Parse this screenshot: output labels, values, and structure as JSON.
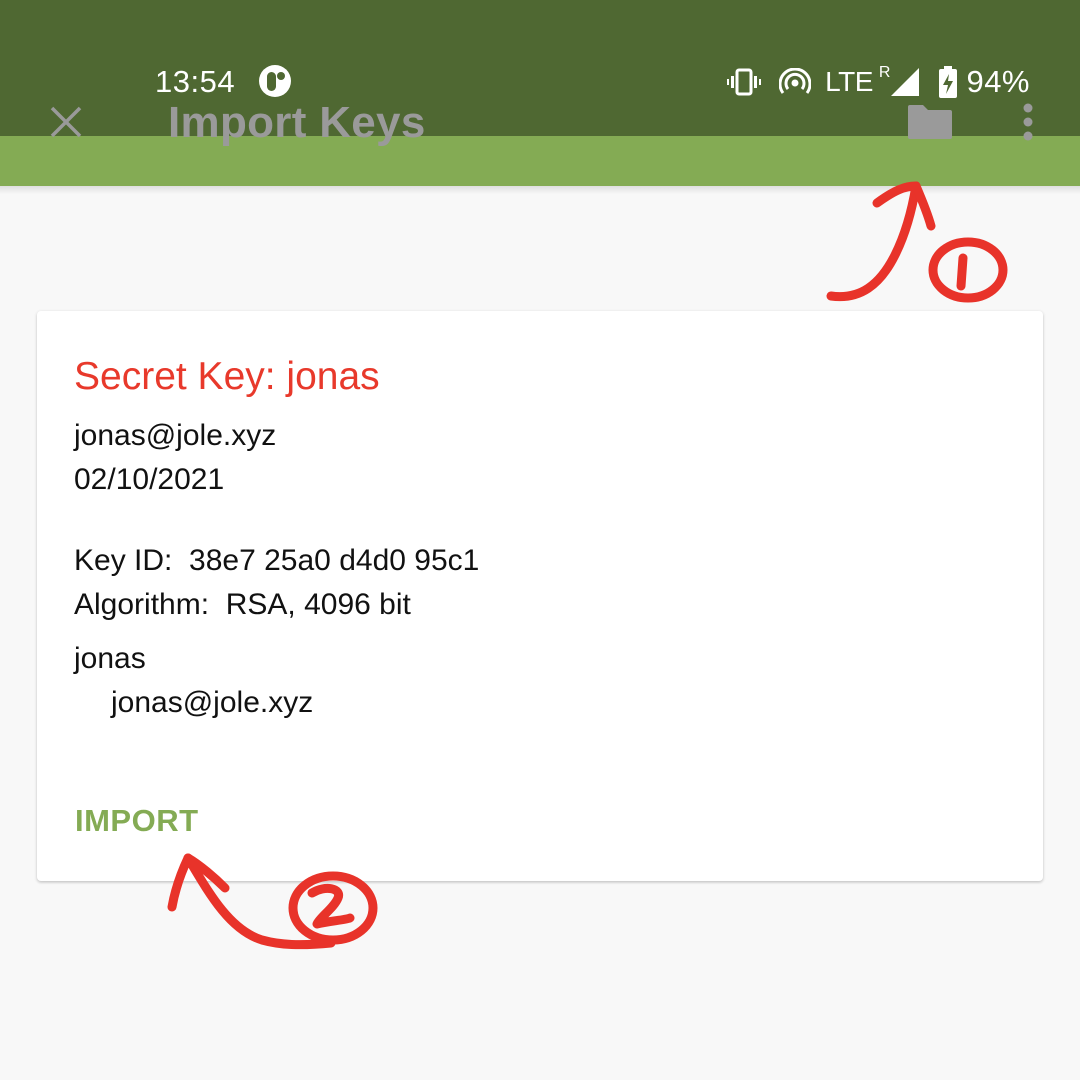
{
  "status_bar": {
    "time": "13:54",
    "app_icon": "pinned-app-icon",
    "icons": [
      "vibrate-icon",
      "hotspot-icon",
      "signal-icon",
      "battery-charging-icon"
    ],
    "network": "LTE",
    "roaming": "R",
    "battery_percent": "94%"
  },
  "toolbar": {
    "title": "Import Keys",
    "close_icon": "close-icon",
    "folder_icon": "folder-icon",
    "overflow_icon": "more-vert-icon",
    "colors": {
      "status_bar": "#4f6832",
      "toolbar": "#84ab54"
    }
  },
  "key_card": {
    "title": "Secret Key: jonas",
    "email": "jonas@jole.xyz",
    "date": "02/10/2021",
    "key_id_label": "Key ID:",
    "key_id": "38e7 25a0 d4d0 95c1",
    "algorithm_label": "Algorithm:",
    "algorithm": "RSA, 4096 bit",
    "user_ids": [
      {
        "name": "jonas",
        "email": "jonas@jole.xyz"
      }
    ],
    "import_label": "IMPORT",
    "colors": {
      "title": "#e8392b",
      "action": "#84ab54"
    }
  },
  "annotations": [
    {
      "label": "1",
      "target": "folder-button"
    },
    {
      "label": "2",
      "target": "import-button"
    }
  ]
}
